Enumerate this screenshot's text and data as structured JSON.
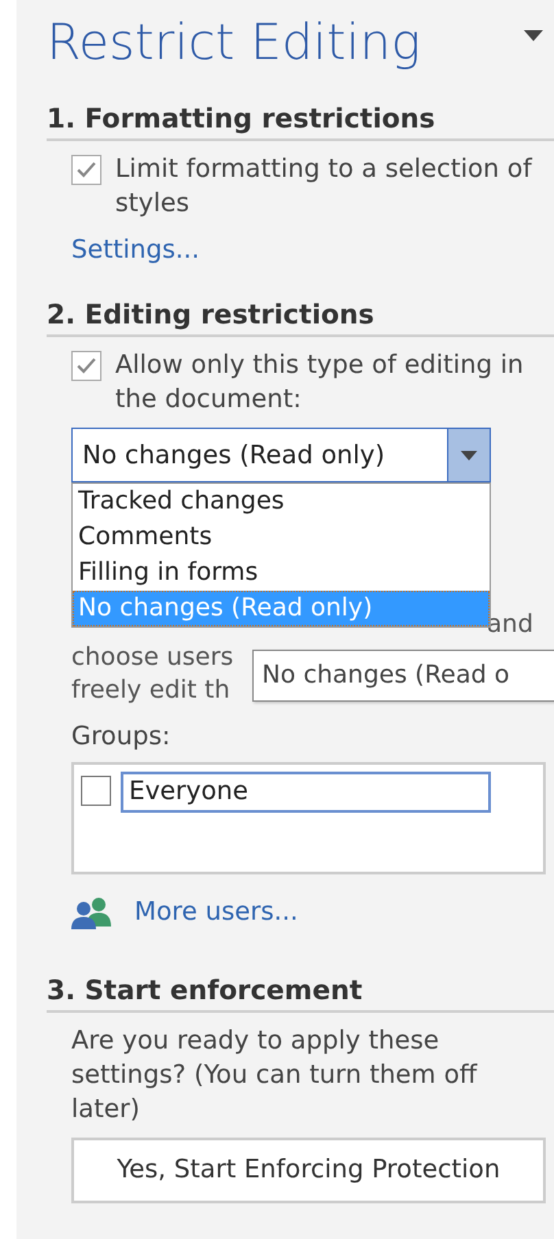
{
  "title": "Restrict Editing",
  "sections": [
    {
      "heading": "1. Formatting restrictions"
    },
    {
      "heading": "2. Editing restrictions"
    },
    {
      "heading": "3. Start enforcement"
    }
  ],
  "formatting": {
    "checkbox": {
      "label": "Limit formatting to a selection of styles",
      "checked": true
    },
    "link": "Settings..."
  },
  "editing": {
    "checkbox": {
      "label": "Allow only this type of editing in the document:",
      "checked": true
    },
    "dropdown": {
      "value": "No changes (Read only)",
      "options": [
        {
          "label": "Tracked changes",
          "selected": false
        },
        {
          "label": "Comments",
          "selected": false
        },
        {
          "label": "Filling in forms",
          "selected": false
        },
        {
          "label": "No changes (Read only)",
          "selected": true
        }
      ]
    },
    "exceptions_visible_text": [
      "and",
      "choose users",
      "freely edit th"
    ],
    "tooltip": "No changes (Read o",
    "groups_label": "Groups:",
    "groups": [
      {
        "label": "Everyone",
        "checked": false
      }
    ],
    "more_users": "More users..."
  },
  "enforcement": {
    "text": "Are you ready to apply these settings? (You can turn them off later)",
    "button": "Yes, Start Enforcing Protection"
  }
}
